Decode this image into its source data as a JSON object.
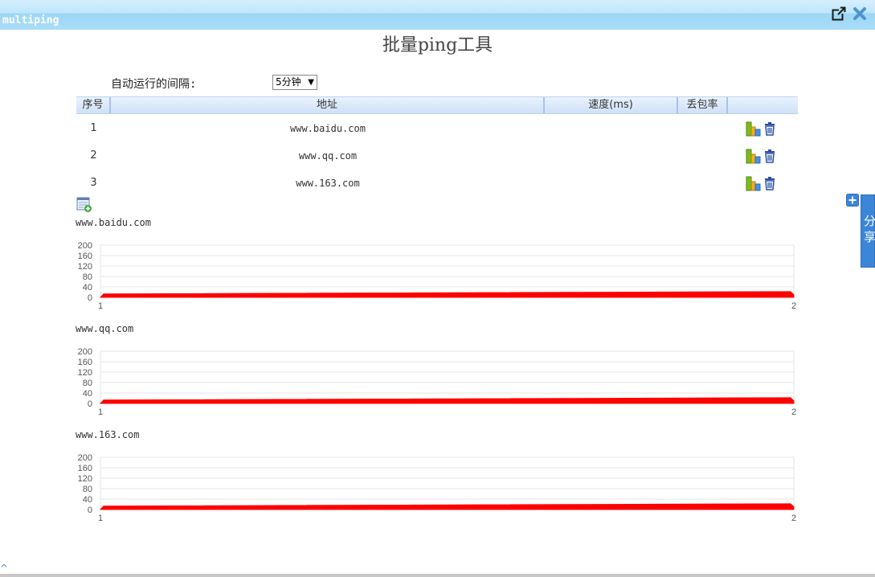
{
  "window": {
    "app_name": "multiping"
  },
  "page": {
    "title": "批量ping工具"
  },
  "interval": {
    "label": "自动运行的间隔:",
    "selected": "5分钟"
  },
  "table": {
    "headers": [
      "序号",
      "地址",
      "速度(ms)",
      "丢包率"
    ],
    "rows": [
      {
        "index": "1",
        "address": "www.baidu.com",
        "speed": "",
        "loss": ""
      },
      {
        "index": "2",
        "address": "www.qq.com",
        "speed": "",
        "loss": ""
      },
      {
        "index": "3",
        "address": "www.163.com",
        "speed": "",
        "loss": ""
      }
    ]
  },
  "share": {
    "label": "分享"
  },
  "colors": {
    "series": "#ff0000",
    "header_bg": "#d9e6f8",
    "titlebar": "#a9ddf8",
    "share_tab": "#3b86d9"
  },
  "icons": {
    "popout": "external-window-icon",
    "close": "close-icon",
    "chart": "bar-chart-icon",
    "delete": "trash-icon",
    "add": "add-row-icon"
  },
  "chart_data": [
    {
      "type": "area",
      "title": "www.baidu.com",
      "x": [
        1,
        2
      ],
      "series": [
        {
          "values": [
            13,
            22
          ]
        }
      ],
      "xlim": [
        1,
        2
      ],
      "ylim": [
        0,
        200
      ],
      "yticks": [
        0,
        40,
        80,
        120,
        160,
        200
      ],
      "xticks": [
        1,
        2
      ],
      "grid": true
    },
    {
      "type": "area",
      "title": "www.qq.com",
      "x": [
        1,
        2
      ],
      "series": [
        {
          "values": [
            13,
            22
          ]
        }
      ],
      "xlim": [
        1,
        2
      ],
      "ylim": [
        0,
        200
      ],
      "yticks": [
        0,
        40,
        80,
        120,
        160,
        200
      ],
      "xticks": [
        1,
        2
      ],
      "grid": true
    },
    {
      "type": "area",
      "title": "www.163.com",
      "x": [
        1,
        2
      ],
      "series": [
        {
          "values": [
            13,
            22
          ]
        }
      ],
      "xlim": [
        1,
        2
      ],
      "ylim": [
        0,
        200
      ],
      "yticks": [
        0,
        40,
        80,
        120,
        160,
        200
      ],
      "xticks": [
        1,
        2
      ],
      "grid": true
    }
  ]
}
